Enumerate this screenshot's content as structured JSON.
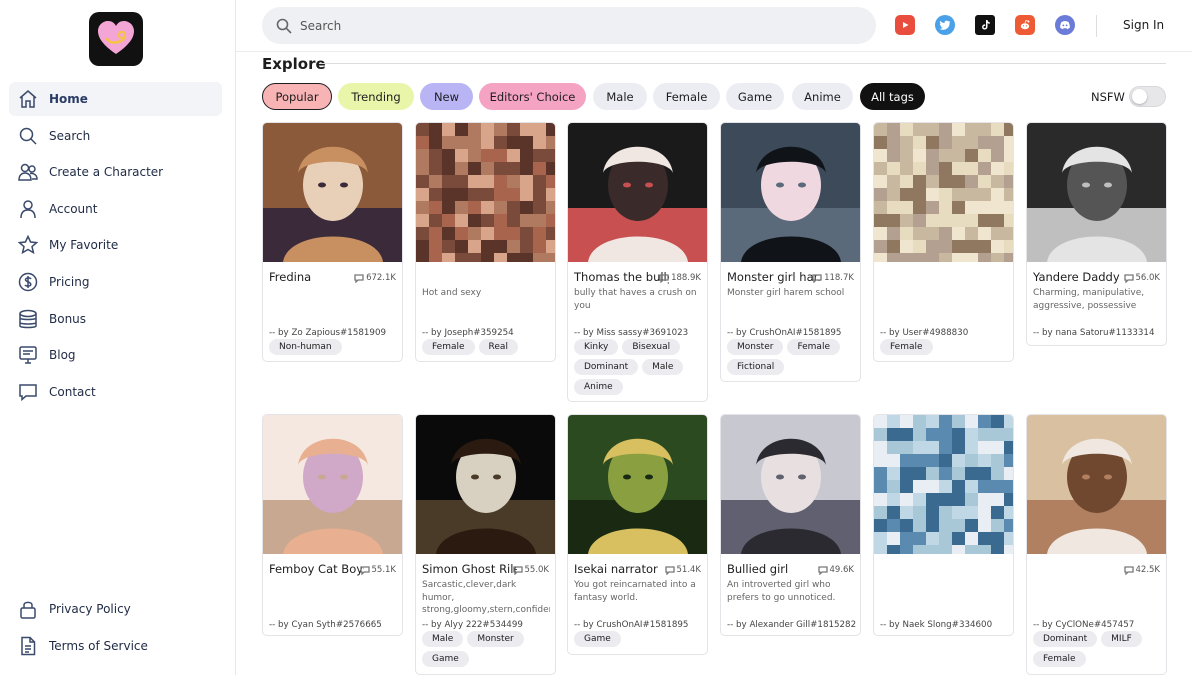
{
  "search": {
    "placeholder": "Search"
  },
  "header": {
    "signin_label": "Sign In"
  },
  "social": [
    {
      "icon": "youtube-icon",
      "color": "#e84d3d"
    },
    {
      "icon": "twitter-icon",
      "color": "#4aa1e8"
    },
    {
      "icon": "tiktok-icon",
      "color": "#111111"
    },
    {
      "icon": "reddit-icon",
      "color": "#ee5a33"
    },
    {
      "icon": "discord-icon",
      "color": "#6b7bd8"
    }
  ],
  "sidebar": {
    "items": [
      {
        "label": "Home",
        "icon": "home-icon"
      },
      {
        "label": "Search",
        "icon": "search-icon"
      },
      {
        "label": "Create a Character",
        "icon": "users-icon"
      },
      {
        "label": "Account",
        "icon": "user-icon"
      },
      {
        "label": "My Favorite",
        "icon": "star-icon"
      },
      {
        "label": "Pricing",
        "icon": "dollar-icon"
      },
      {
        "label": "Bonus",
        "icon": "coins-icon"
      },
      {
        "label": "Blog",
        "icon": "monitor-icon"
      },
      {
        "label": "Contact",
        "icon": "chat-icon"
      }
    ],
    "bottom_items": [
      {
        "label": "Privacy Policy",
        "icon": "lock-icon"
      },
      {
        "label": "Terms of Service",
        "icon": "document-icon"
      }
    ]
  },
  "explore": {
    "title": "Explore"
  },
  "tags": [
    {
      "label": "Popular",
      "color": "#f8b4b4",
      "active": true
    },
    {
      "label": "Trending",
      "color": "#e9f5a8"
    },
    {
      "label": "New",
      "color": "#b9b5f4"
    },
    {
      "label": "Editors' Choice",
      "color": "#f5a3c2"
    },
    {
      "label": "Male",
      "color": "#ececf3"
    },
    {
      "label": "Female",
      "color": "#ececf3"
    },
    {
      "label": "Game",
      "color": "#ececf3"
    },
    {
      "label": "Anime",
      "color": "#ececf3"
    },
    {
      "label": "All tags",
      "color": "#111111"
    }
  ],
  "nsfw": {
    "label": "NSFW",
    "enabled": false
  },
  "cards": [
    {
      "name": "Fredina",
      "views": "672.1K",
      "desc": "",
      "author": "-- by Zo Zapious#1581909",
      "tags": [
        "Non-human"
      ],
      "blurred": false
    },
    {
      "name": "",
      "views": "",
      "desc": "Hot and sexy",
      "author": "-- by Joseph#359254",
      "tags": [
        "Female",
        "Real"
      ],
      "blurred": true
    },
    {
      "name": "Thomas the bully",
      "views": "188.9K",
      "desc": "bully that haves a crush on you",
      "author": "-- by Miss sassy#3691023",
      "tags": [
        "Kinky",
        "Bisexual",
        "Dominant",
        "Male",
        "Anime"
      ],
      "blurred": false
    },
    {
      "name": "Monster girl har...",
      "views": "118.7K",
      "desc": "Monster girl harem school",
      "author": "-- by CrushOnAI#1581895",
      "tags": [
        "Monster",
        "Female",
        "Fictional"
      ],
      "blurred": false
    },
    {
      "name": "",
      "views": "",
      "desc": "",
      "author": "-- by User#4988830",
      "tags": [
        "Female"
      ],
      "blurred": true
    },
    {
      "name": "Yandere Daddy",
      "views": "56.0K",
      "desc": "Charming, manipulative, aggressive, possessive",
      "author": "-- by nana Satoru#1133314",
      "tags": [],
      "blurred": false
    },
    {
      "name": "Femboy Cat Boys",
      "views": "55.1K",
      "desc": "",
      "author": "-- by Cyan Syth#2576665",
      "tags": [],
      "blurred": false
    },
    {
      "name": "Simon Ghost Riley",
      "views": "55.0K",
      "desc": "Sarcastic,clever,dark humor, strong,gloomy,stern,confiden",
      "author": "-- by Alyy 222#534499",
      "tags": [
        "Male",
        "Monster",
        "Game"
      ],
      "blurred": false
    },
    {
      "name": "Isekai narrator",
      "views": "51.4K",
      "desc": "You got reincarnated into a fantasy world.",
      "author": "-- by CrushOnAI#1581895",
      "tags": [
        "Game"
      ],
      "blurred": false
    },
    {
      "name": "Bullied girl",
      "views": "49.6K",
      "desc": "An introverted girl who prefers to go unnoticed.",
      "author": "-- by Alexander Gill#1815282",
      "tags": [],
      "blurred": false
    },
    {
      "name": "",
      "views": "",
      "desc": "",
      "author": "-- by Naek Slong#334600",
      "tags": [],
      "blurred": true
    },
    {
      "name": "",
      "views": "42.5K",
      "desc": "",
      "author": "-- by CyClONe#457457",
      "tags": [
        "Dominant",
        "MILF",
        "Female"
      ],
      "blurred": false
    }
  ]
}
